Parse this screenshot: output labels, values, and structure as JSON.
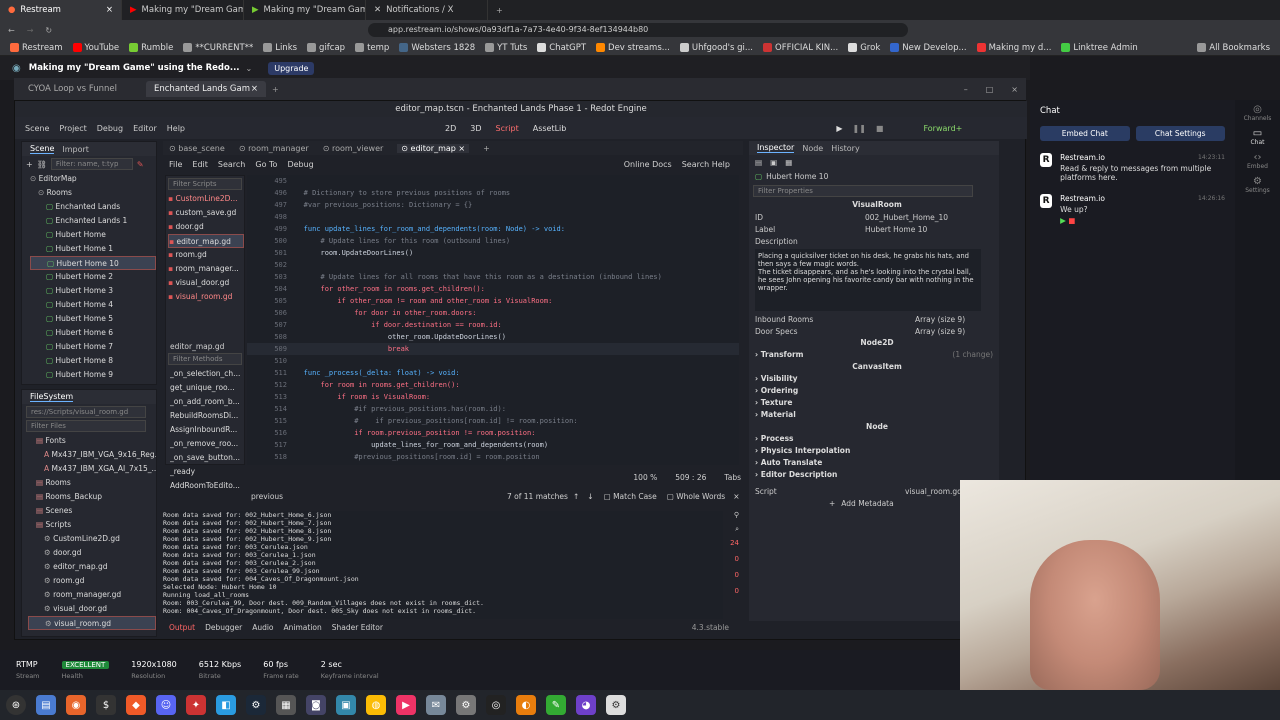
{
  "browser": {
    "tabs": [
      "Restream",
      "Making my \"Dream Game",
      "Making my \"Dream Game",
      "Notifications / X"
    ],
    "url": "app.restream.io/shows/0a93df1a-7a73-4e40-9f34-8ef134944b80",
    "bookmarks": [
      "Restream",
      "YouTube",
      "Rumble",
      "**CURRENT**",
      "Links",
      "gifcap",
      "temp",
      "Websters 1828",
      "YT Tuts",
      "ChatGPT",
      "Dev streams...",
      "Uhfgood's gi...",
      "OFFICIAL KIN...",
      "Grok",
      "New Develop...",
      "Making my d...",
      "Linktree Admin",
      "All Bookmarks"
    ]
  },
  "restream": {
    "stream_title": "Making my \"Dream Game\" using the Redo...",
    "upgrade": "Upgrade"
  },
  "os_window": {
    "tabs": [
      "CYOA Loop vs Funnel",
      "Enchanted Lands Gam"
    ]
  },
  "godot": {
    "title": "editor_map.tscn - Enchanted Lands Phase 1 - Redot Engine",
    "menu": [
      "Scene",
      "Project",
      "Debug",
      "Editor",
      "Help"
    ],
    "workspaces": [
      "2D",
      "3D",
      "Script",
      "AssetLib"
    ],
    "renderer": "Forward+",
    "scene_tabs": [
      "Scene",
      "Import"
    ],
    "filter_nodes": "Filter: name, t:typ",
    "scene_tree": [
      "EditorMap",
      "Rooms",
      "Enchanted Lands",
      "Enchanted Lands 1",
      "Hubert Home",
      "Hubert Home 1",
      "Hubert Home 10",
      "Hubert Home 2",
      "Hubert Home 3",
      "Hubert Home 4",
      "Hubert Home 5",
      "Hubert Home 6",
      "Hubert Home 7",
      "Hubert Home 8",
      "Hubert Home 9"
    ],
    "filesystem": {
      "title": "FileSystem",
      "path": "res://Scripts/visual_room.gd",
      "filter": "Filter Files",
      "items": [
        "Fonts",
        "Mx437_IBM_VGA_9x16_Reg...",
        "Mx437_IBM_XGA_AI_7x15_...",
        "Rooms",
        "Rooms_Backup",
        "Scenes",
        "Scripts",
        "CustomLine2D.gd",
        "door.gd",
        "editor_map.gd",
        "room.gd",
        "room_manager.gd",
        "visual_door.gd",
        "visual_room.gd"
      ]
    },
    "script_tabs": [
      "base_scene",
      "room_manager",
      "room_viewer",
      "editor_map"
    ],
    "script_menu": [
      "File",
      "Edit",
      "Search",
      "Go To",
      "Debug"
    ],
    "online_docs": "Online Docs",
    "search_help": "Search Help",
    "filter_scripts": "Filter Scripts",
    "scripts": [
      "CustomLine2D...",
      "custom_save.gd",
      "door.gd",
      "editor_map.gd",
      "room.gd",
      "room_manager...",
      "visual_door.gd",
      "visual_room.gd"
    ],
    "current_script": "editor_map.gd",
    "filter_methods": "Filter Methods",
    "methods": [
      "_on_selection_ch...",
      "get_unique_roo...",
      "_on_add_room_b...",
      "RebuildRoomsDi...",
      "AssignInboundR...",
      "_on_remove_roo...",
      "_on_save_button...",
      "_ready",
      "AddRoomToEdito..."
    ],
    "code": [
      {
        "n": "495",
        "t": ""
      },
      {
        "n": "496",
        "t": "# Dictionary to store previous positions of rooms"
      },
      {
        "n": "497",
        "t": "#var previous_positions: Dictionary = {}"
      },
      {
        "n": "498",
        "t": ""
      },
      {
        "n": "499",
        "t": "func update_lines_for_room_and_dependents(room: Node) -> void:"
      },
      {
        "n": "500",
        "t": "    # Update lines for this room (outbound lines)"
      },
      {
        "n": "501",
        "t": "    room.UpdateDoorLines()"
      },
      {
        "n": "502",
        "t": ""
      },
      {
        "n": "503",
        "t": "    # Update lines for all rooms that have this room as a destination (inbound lines)"
      },
      {
        "n": "504",
        "t": "    for other_room in rooms.get_children():"
      },
      {
        "n": "505",
        "t": "        if other_room != room and other_room is VisualRoom:"
      },
      {
        "n": "506",
        "t": "            for door in other_room.doors:"
      },
      {
        "n": "507",
        "t": "                if door.destination == room.id:"
      },
      {
        "n": "508",
        "t": "                    other_room.UpdateDoorLines()"
      },
      {
        "n": "509",
        "t": "                    break"
      },
      {
        "n": "510",
        "t": ""
      },
      {
        "n": "511",
        "t": "func _process(_delta: float) -> void:"
      },
      {
        "n": "512",
        "t": "    for room in rooms.get_children():"
      },
      {
        "n": "513",
        "t": "        if room is VisualRoom:"
      },
      {
        "n": "514",
        "t": "            #if previous_positions.has(room.id):"
      },
      {
        "n": "515",
        "t": "            #    if previous_positions[room.id] != room.position:"
      },
      {
        "n": "516",
        "t": "            if room.previous_position != room.position:"
      },
      {
        "n": "517",
        "t": "                update_lines_for_room_and_dependents(room)"
      },
      {
        "n": "518",
        "t": "            #previous_positions[room.id] = room.position"
      }
    ],
    "zoom": "100 %",
    "cursor": "509 :   26",
    "indent": "Tabs",
    "search_text": "previous",
    "matches": "7 of 11 matches",
    "match_case": "Match Case",
    "whole_words": "Whole Words",
    "output_lines": [
      "Room data saved for: 002_Hubert_Home_6.json",
      "Room data saved for: 002_Hubert_Home_7.json",
      "Room data saved for: 002_Hubert_Home_8.json",
      "Room data saved for: 002_Hubert_Home_9.json",
      "Room data saved for: 003_Cerulea.json",
      "Room data saved for: 003_Cerulea_1.json",
      "Room data saved for: 003_Cerulea_2.json",
      "Room data saved for: 003_Cerulea_99.json",
      "Room data saved for: 004_Caves_Of_Dragonmount.json",
      "Selected Node: Hubert Home 10",
      "Running load_all_rooms",
      "Room: 003_Cerulea_99, Door dest. 009_Random_Villages does not exist in rooms_dict.",
      "Room: 004_Caves_Of_Dragonmount, Door dest. 005_Sky does not exist in rooms_dict."
    ],
    "counters": [
      "24",
      "0",
      "0",
      "0"
    ],
    "bottom_tabs": [
      "Output",
      "Debugger",
      "Audio",
      "Animation",
      "Shader Editor"
    ],
    "version": "4.3.stable",
    "inspector": {
      "tabs": [
        "Inspector",
        "Node",
        "History"
      ],
      "node_name": "Hubert Home 10",
      "filter": "Filter Properties",
      "class": "VisualRoom",
      "props": [
        {
          "k": "ID",
          "v": "002_Hubert_Home_10"
        },
        {
          "k": "Label",
          "v": "Hubert Home 10"
        },
        {
          "k": "Description",
          "v": ""
        }
      ],
      "description": "Placing a quicksilver ticket on his desk, he grabs his hats, and then says a few magic words.\nThe ticket disappears, and as he's looking into the crystal ball, he sees John opening his favorite candy bar with nothing in the wrapper.",
      "inbound_rooms": "Inbound Rooms",
      "inbound_val": "Array (size 9)",
      "door_specs": "Door Specs",
      "door_val": "Array (size 9)",
      "node2d": "Node2D",
      "transform": "Transform",
      "transform_note": "(1 change)",
      "canvas": "CanvasItem",
      "canvas_sections": [
        "Visibility",
        "Ordering",
        "Texture",
        "Material"
      ],
      "node": "Node",
      "node_sections": [
        "Process",
        "Physics Interpolation",
        "Auto Translate",
        "Editor Description"
      ],
      "script_label": "Script",
      "script_val": "visual_room.gd",
      "add_metadata": "Add Metadata"
    }
  },
  "chat": {
    "title": "Chat",
    "embed": "Embed Chat",
    "settings": "Chat Settings",
    "messages": [
      {
        "user": "Restream.io",
        "time": "14:23:11",
        "text": "Read & reply to messages from multiple platforms here."
      },
      {
        "user": "Restream.io",
        "time": "14:26:16",
        "text": "We up?"
      }
    ],
    "side": [
      "Channels",
      "Chat",
      "Embed",
      "Settings"
    ]
  },
  "stats": [
    {
      "v": "RTMP",
      "l": "Stream"
    },
    {
      "v": "EXCELLENT",
      "l": "Health"
    },
    {
      "v": "1920x1080",
      "l": "Resolution"
    },
    {
      "v": "6512 Kbps",
      "l": "Bitrate"
    },
    {
      "v": "60 fps",
      "l": "Frame rate"
    },
    {
      "v": "2 sec",
      "l": "Keyframe interval"
    }
  ]
}
